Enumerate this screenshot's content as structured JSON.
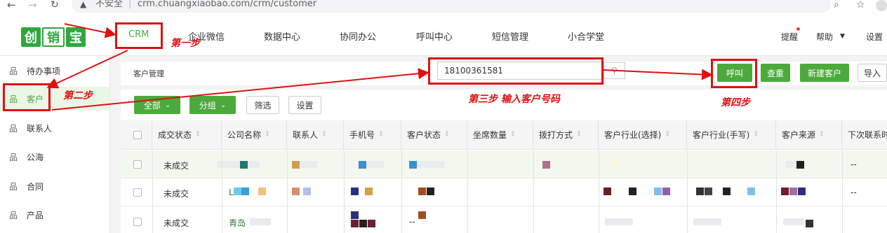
{
  "browser": {
    "back_icon": "back-arrow-icon",
    "forward_icon": "forward-arrow-icon",
    "insecure_label": "不安全",
    "url": "crm.chuangxiaobao.com/crm/customer"
  },
  "logo": {
    "chars": [
      "创",
      "销",
      "宝"
    ]
  },
  "topnav": {
    "items": [
      "CRM",
      "企业微信",
      "数据中心",
      "协同办公",
      "呼叫中心",
      "短信管理",
      "小合学堂"
    ],
    "right": {
      "remind": "提醒",
      "help": "帮助",
      "settings": "设置"
    }
  },
  "sidebar": {
    "items": [
      "待办事项",
      "客户",
      "联系人",
      "公海",
      "合同",
      "产品"
    ]
  },
  "main": {
    "breadcrumb": "客户管理",
    "search_value": "18100361581",
    "buttons": {
      "call": "呼叫",
      "check_dup": "查重",
      "new_customer": "新建客户",
      "import": "导入"
    },
    "filters": {
      "all": "全部",
      "group": "分组",
      "filter": "筛选",
      "settings": "设置"
    }
  },
  "table": {
    "columns": [
      "成交状态",
      "公司名称",
      "联系人",
      "手机号",
      "客户状态",
      "坐席数量",
      "拨打方式",
      "客户行业(选择)",
      "客户行业(手写)",
      "客户来源",
      "下次联系时"
    ],
    "rows": [
      {
        "deal_status": "未成交",
        "company": "",
        "phone": "",
        "next_contact": "--"
      },
      {
        "deal_status": "未成交",
        "company": "L",
        "phone": "",
        "next_contact": "--"
      },
      {
        "deal_status": "未成交",
        "company": "青岛",
        "phone": "--",
        "next_contact": ""
      }
    ]
  },
  "annotations": {
    "step1": "第一步",
    "step2": "第二步",
    "step3": "第三步   输入客户号码",
    "step4": "第四步"
  },
  "colors": {
    "accent_green": "#4caa3c",
    "annotation_red": "#e01010"
  }
}
